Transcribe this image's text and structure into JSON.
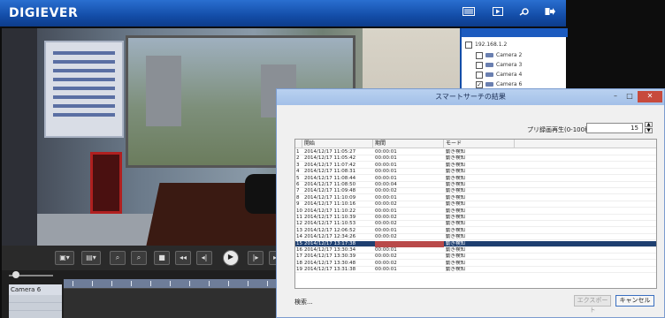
{
  "header": {
    "logo": "DIGIEVER"
  },
  "timeline": {
    "camera_label": "Camera 6"
  },
  "device_tree": {
    "root": "192.168.1.2",
    "cameras": [
      {
        "label": "Camera 2",
        "checked": false
      },
      {
        "label": "Camera 3",
        "checked": false
      },
      {
        "label": "Camera 4",
        "checked": false
      },
      {
        "label": "Camera 6",
        "checked": true
      }
    ]
  },
  "dialog": {
    "title": "スマートサーチの結果",
    "preplay_label": "プリ録画再生(0-100秒)",
    "preplay_value": "15",
    "columns": [
      "開始",
      "期間",
      "モード"
    ],
    "rows": [
      [
        "1",
        "2014/12/17 11:05:27",
        "00:00:01",
        "動き検知"
      ],
      [
        "2",
        "2014/12/17 11:05:42",
        "00:00:01",
        "動き検知"
      ],
      [
        "3",
        "2014/12/17 11:07:42",
        "00:00:01",
        "動き検知"
      ],
      [
        "4",
        "2014/12/17 11:08:31",
        "00:00:01",
        "動き検知"
      ],
      [
        "5",
        "2014/12/17 11:08:44",
        "00:00:01",
        "動き検知"
      ],
      [
        "6",
        "2014/12/17 11:08:50",
        "00:00:04",
        "動き検知"
      ],
      [
        "7",
        "2014/12/17 11:09:48",
        "00:00:02",
        "動き検知"
      ],
      [
        "8",
        "2014/12/17 11:10:09",
        "00:00:01",
        "動き検知"
      ],
      [
        "9",
        "2014/12/17 11:10:16",
        "00:00:02",
        "動き検知"
      ],
      [
        "10",
        "2014/12/17 11:10:22",
        "00:00:01",
        "動き検知"
      ],
      [
        "11",
        "2014/12/17 11:10:39",
        "00:00:02",
        "動き検知"
      ],
      [
        "12",
        "2014/12/17 11:10:53",
        "00:00:02",
        "動き検知"
      ],
      [
        "13",
        "2014/12/17 12:06:52",
        "00:00:01",
        "動き検知"
      ],
      [
        "14",
        "2014/12/17 12:34:26",
        "00:00:02",
        "動き検知"
      ],
      [
        "15",
        "2014/12/17 13:17:38",
        "00:00:06",
        "動き検知"
      ],
      [
        "16",
        "2014/12/17 13:30:34",
        "00:00:01",
        "動き検知"
      ],
      [
        "17",
        "2014/12/17 13:30:39",
        "00:00:02",
        "動き検知"
      ],
      [
        "18",
        "2014/12/17 13:30:48",
        "00:00:02",
        "動き検知"
      ],
      [
        "19",
        "2014/12/17 13:31:38",
        "00:00:01",
        "動き検知"
      ]
    ],
    "selected_row": 15,
    "status": "検索...",
    "export_label": "エクスポート",
    "cancel_label": "キャンセル"
  },
  "colors": {
    "header_blue": "#134da8",
    "selected_row": "#1e3f70",
    "duration_highlight": "#b94a4a"
  }
}
